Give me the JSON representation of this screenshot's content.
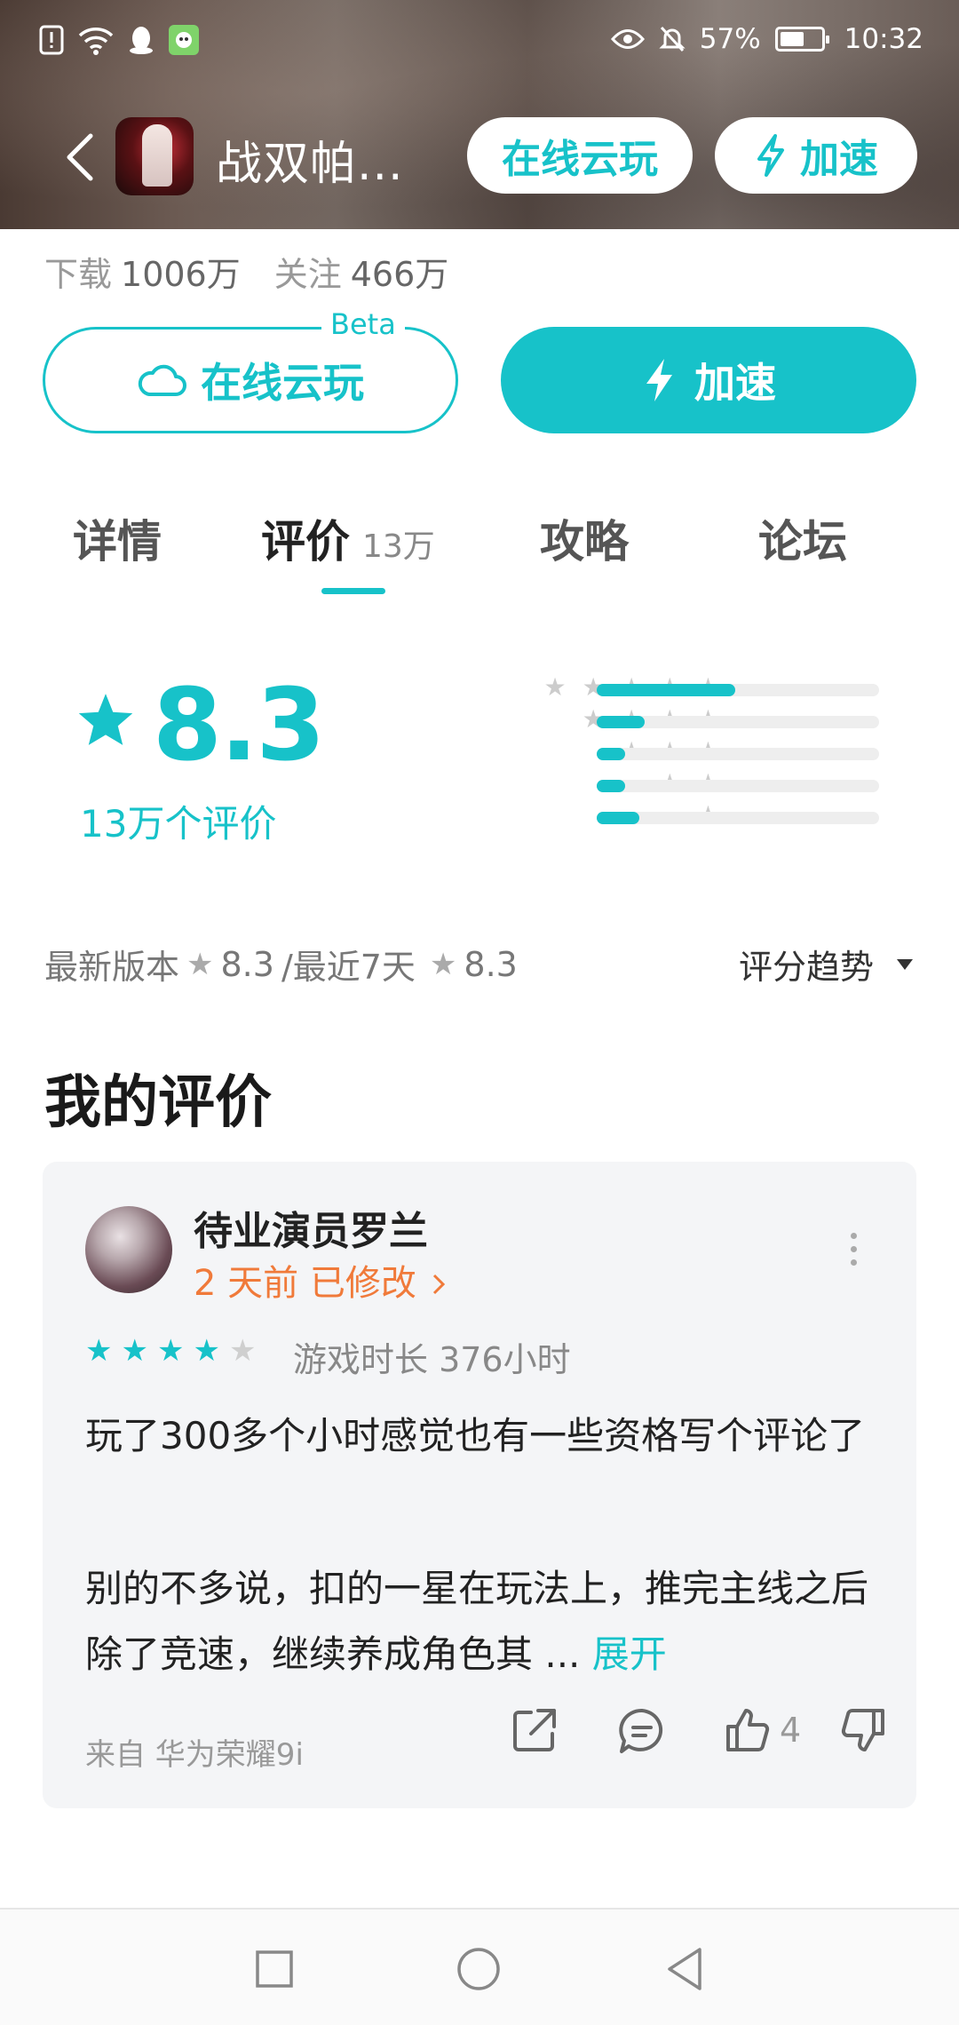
{
  "status_bar": {
    "battery": "57%",
    "time": "10:32"
  },
  "header": {
    "title": "战双帕...",
    "cloud_play": "在线云玩",
    "accelerate": "加速"
  },
  "stats": {
    "download_label": "下载",
    "download_value": "1006万",
    "follow_label": "关注",
    "follow_value": "466万"
  },
  "actions": {
    "cloud_play": "在线云玩",
    "beta": "Beta",
    "accelerate": "加速"
  },
  "tabs": [
    {
      "label": "详情"
    },
    {
      "label": "评价",
      "count": "13万"
    },
    {
      "label": "攻略"
    },
    {
      "label": "论坛"
    }
  ],
  "rating": {
    "score": "8.3",
    "count": "13万个评价",
    "distribution": [
      {
        "stars": 5,
        "fraction": 0.49
      },
      {
        "stars": 4,
        "fraction": 0.17
      },
      {
        "stars": 3,
        "fraction": 0.1
      },
      {
        "stars": 2,
        "fraction": 0.1
      },
      {
        "stars": 1,
        "fraction": 0.15
      }
    ],
    "latest_version_label": "最新版本",
    "latest_version_score": "8.3",
    "recent_label": "/最近7天",
    "recent_score": "8.3",
    "trend": "评分趋势"
  },
  "my_review": {
    "section_title": "我的评价",
    "username": "待业演员罗兰",
    "edited": "2 天前 已修改",
    "stars": 4,
    "play_time": "游戏时长 376小时",
    "paragraph1": "玩了300多个小时感觉也有一些资格写个评论了",
    "paragraph2": "别的不多说，扣的一星在玩法上，推完主线之后除了竞速，继续养成角色其 ...",
    "expand": "展开",
    "device": "来自 华为荣耀9i",
    "like_count": "4"
  },
  "colors": {
    "accent": "#17c2c9",
    "edited": "#f07a3a"
  }
}
